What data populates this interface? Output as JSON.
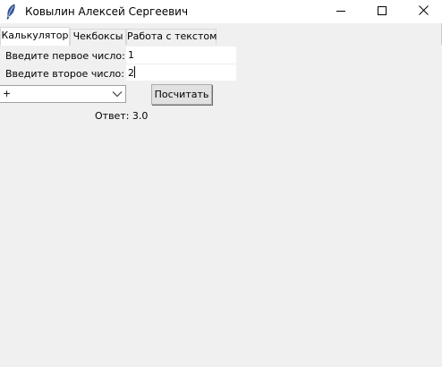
{
  "window": {
    "title": "Ковылин Алексей Сергеевич",
    "icon": "feather-icon",
    "controls": {
      "minimize_icon": "minimize-icon",
      "maximize_icon": "maximize-icon",
      "close_icon": "close-icon"
    }
  },
  "tabs": [
    {
      "label": "Калькулятор",
      "active": true
    },
    {
      "label": "Чекбоксы",
      "active": false
    },
    {
      "label": "Работа с текстом",
      "active": false
    }
  ],
  "calculator": {
    "first_label": "Введите первое число:",
    "first_value": "1",
    "second_label": "Введите второе число:",
    "second_value": "2",
    "operation_value": "+",
    "operation_arrow_icon": "chevron-down-icon",
    "calculate_button": "Посчитать",
    "answer_text": "Ответ: 3.0"
  }
}
